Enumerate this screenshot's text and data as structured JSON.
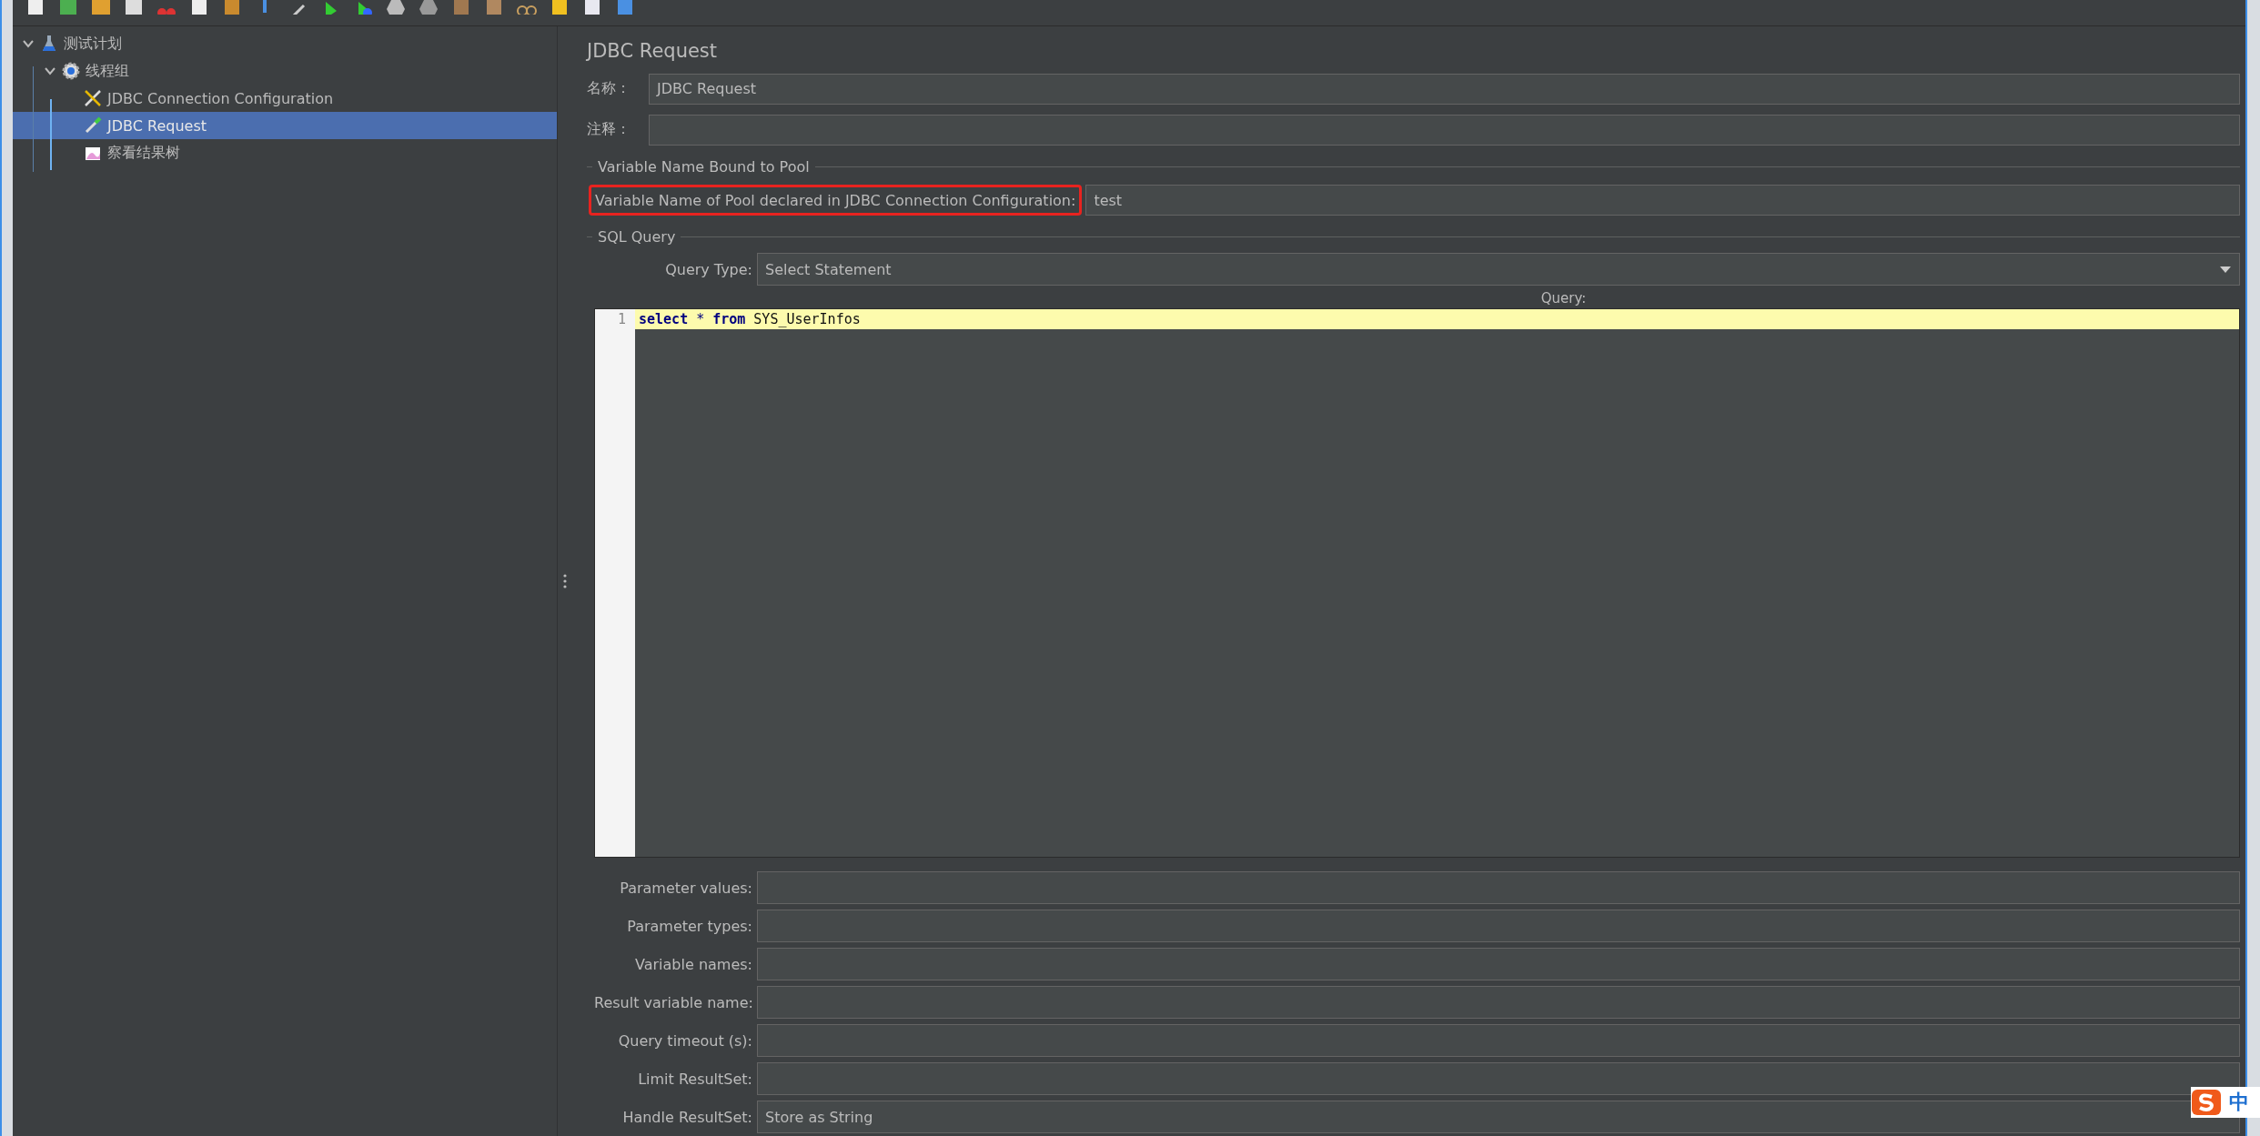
{
  "tree": [
    {
      "label": "测试计划",
      "kind": "test-plan",
      "expanded": true,
      "selected": false,
      "children": [
        {
          "label": "线程组",
          "kind": "thread-group",
          "expanded": true,
          "selected": false,
          "children": [
            {
              "label": "JDBC Connection Configuration",
              "kind": "config",
              "selected": false
            },
            {
              "label": "JDBC Request",
              "kind": "sampler",
              "selected": true
            },
            {
              "label": "察看结果树",
              "kind": "listener",
              "selected": false
            }
          ]
        }
      ]
    }
  ],
  "editor": {
    "title": "JDBC Request",
    "fields": [
      {
        "label": "名称：",
        "value": "JDBC Request"
      },
      {
        "label": "注释："
      }
    ],
    "pool_section": {
      "title": "Variable Name Bound to Pool",
      "label": "Variable Name of Pool declared in JDBC Connection Configuration:",
      "value": "test",
      "highlighted": true
    },
    "sql_section": {
      "title": "SQL Query",
      "query_type": {
        "label": "Query Type:",
        "value": "Select Statement"
      },
      "query_label": "Query:",
      "lines": [
        {
          "number": "1",
          "current": true,
          "tokens": [
            {
              "text": "select",
              "kind": "keyword"
            },
            {
              "text": "*",
              "kind": "operator"
            },
            {
              "text": "from",
              "kind": "keyword"
            },
            {
              "text": "SYS_UserInfos",
              "kind": "plain"
            }
          ]
        }
      ]
    },
    "params": [
      {
        "label": "Parameter values:"
      },
      {
        "label": "Parameter types:"
      },
      {
        "label": "Variable names:"
      },
      {
        "label": "Result variable name:"
      },
      {
        "label": "Query timeout (s):"
      },
      {
        "label": "Limit ResultSet:"
      },
      {
        "label": "Handle ResultSet:",
        "value": "Store as String"
      }
    ]
  },
  "ime": {
    "label": "中"
  }
}
